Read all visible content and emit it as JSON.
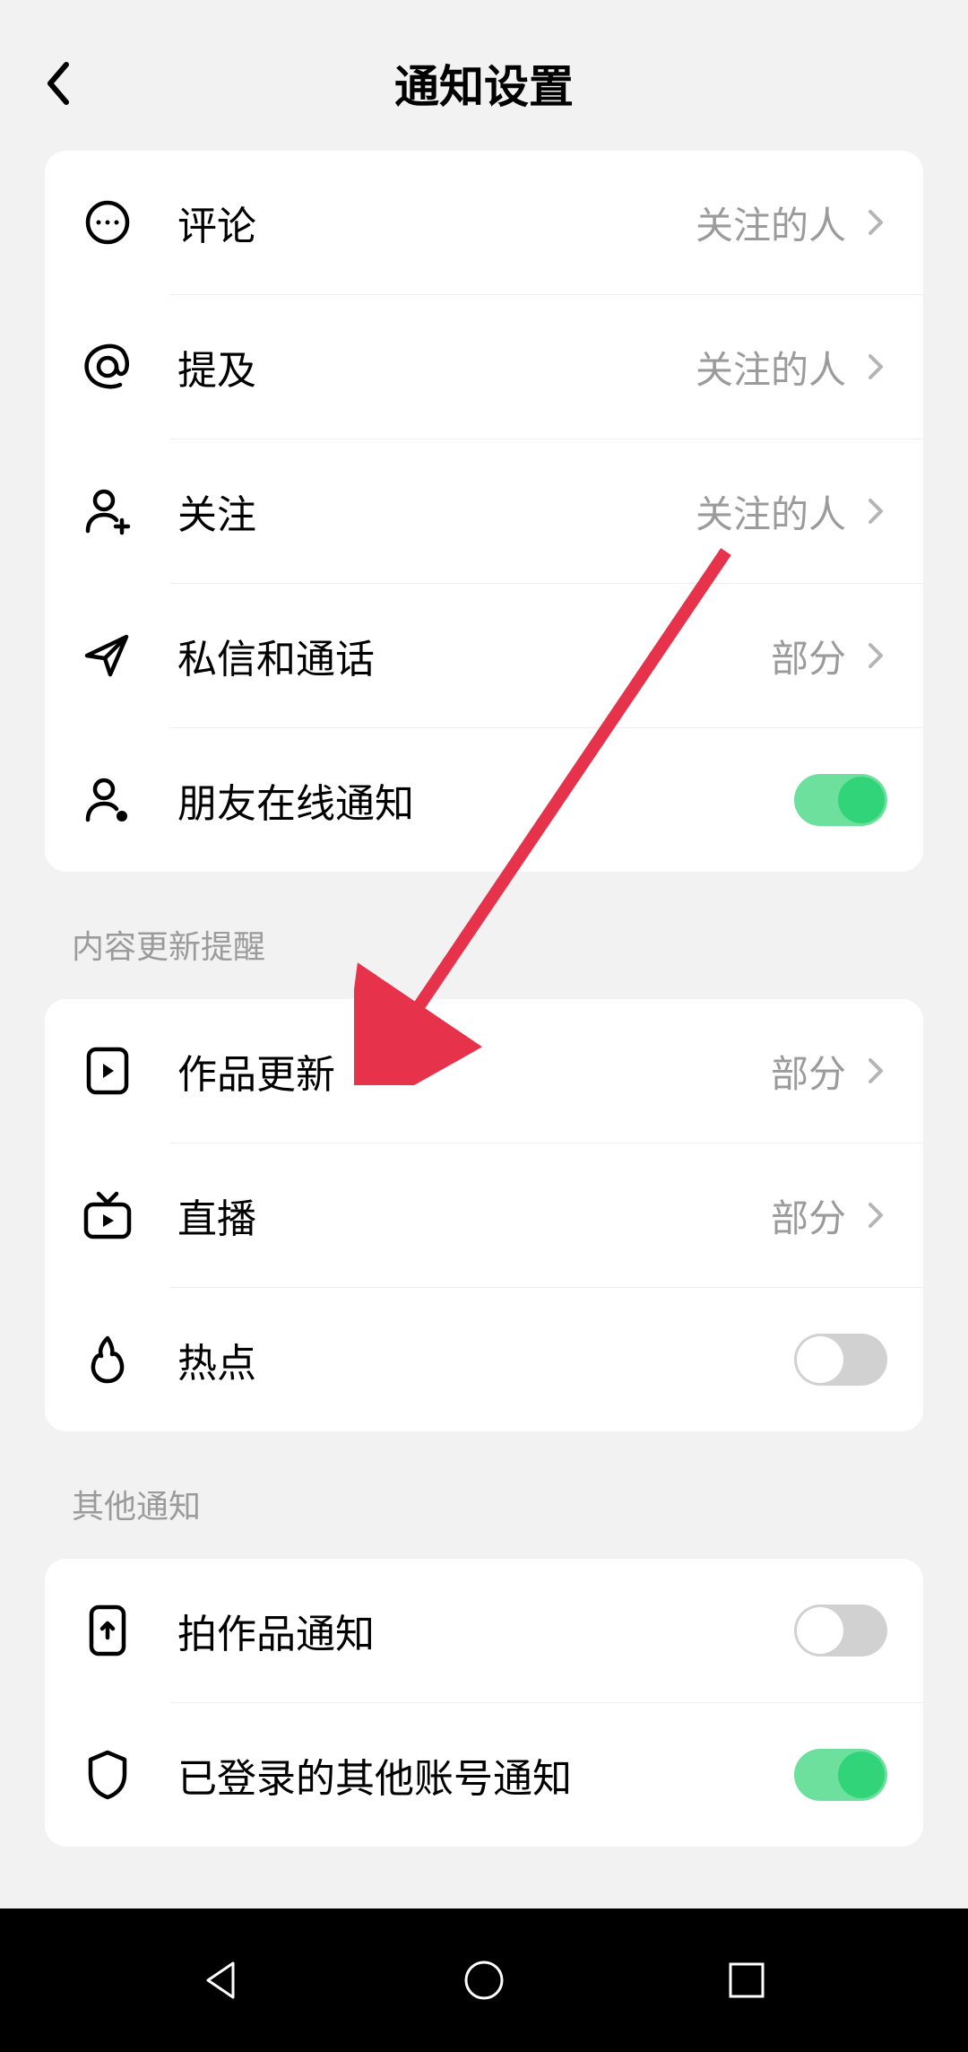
{
  "header": {
    "title": "通知设置"
  },
  "section1": {
    "rows": [
      {
        "label": "评论",
        "value": "关注的人",
        "type": "chevron"
      },
      {
        "label": "提及",
        "value": "关注的人",
        "type": "chevron"
      },
      {
        "label": "关注",
        "value": "关注的人",
        "type": "chevron"
      },
      {
        "label": "私信和通话",
        "value": "部分",
        "type": "chevron"
      },
      {
        "label": "朋友在线通知",
        "type": "toggle",
        "on": true
      }
    ]
  },
  "section2": {
    "header": "内容更新提醒",
    "rows": [
      {
        "label": "作品更新",
        "value": "部分",
        "type": "chevron"
      },
      {
        "label": "直播",
        "value": "部分",
        "type": "chevron"
      },
      {
        "label": "热点",
        "type": "toggle",
        "on": false
      }
    ]
  },
  "section3": {
    "header": "其他通知",
    "rows": [
      {
        "label": "拍作品通知",
        "type": "toggle",
        "on": false
      },
      {
        "label": "已登录的其他账号通知",
        "type": "toggle",
        "on": true
      }
    ]
  }
}
